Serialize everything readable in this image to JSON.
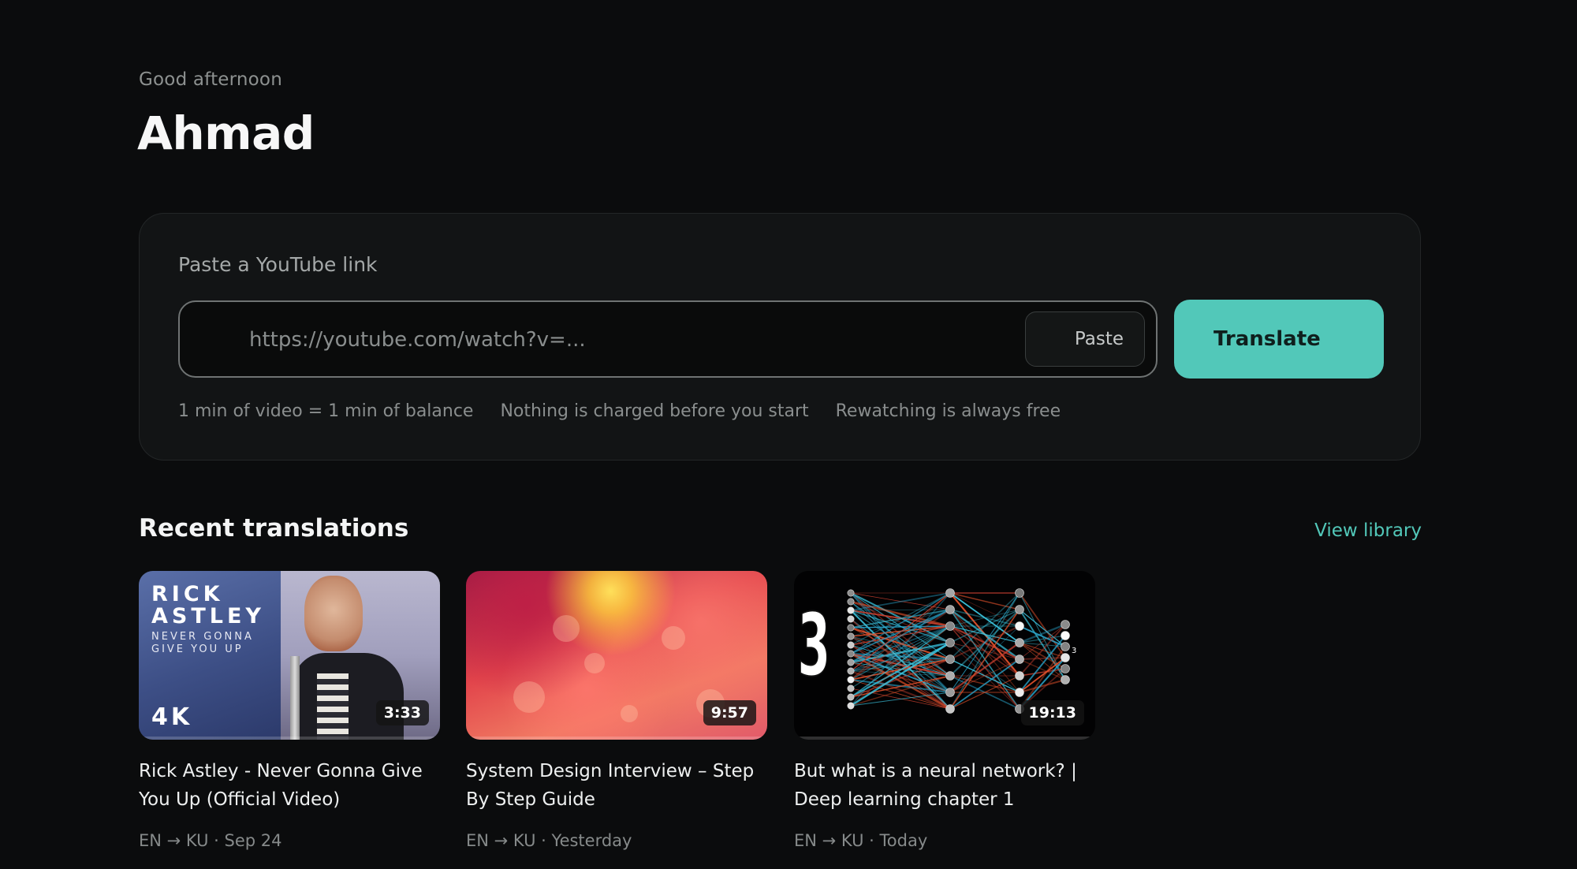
{
  "header": {
    "greeting": "Good afternoon",
    "username": "Ahmad"
  },
  "translate_card": {
    "label": "Paste a YouTube link",
    "url_placeholder": "https://youtube.com/watch?v=...",
    "url_value": "",
    "paste_label": "Paste",
    "translate_label": "Translate",
    "notes": [
      "1 min of video = 1 min of balance",
      "Nothing is charged before you start",
      "Rewatching is always free"
    ]
  },
  "recent": {
    "title": "Recent translations",
    "view_library_label": "View library",
    "items": [
      {
        "title": "Rick Astley - Never Gonna Give You Up (Official Video)",
        "duration": "3:33",
        "meta": "EN → KU · Sep 24",
        "thumb_text": {
          "name_line1": "RICK",
          "name_line2": "ASTLEY",
          "sub_line1": "NEVER GONNA",
          "sub_line2": "GIVE YOU UP",
          "badge": "4K"
        }
      },
      {
        "title": "System Design Interview – Step By Step Guide",
        "duration": "9:57",
        "meta": "EN → KU · Yesterday"
      },
      {
        "title": "But what is a neural network? | Deep learning chapter 1",
        "duration": "19:13",
        "meta": "EN → KU · Today",
        "thumb_text": {
          "digit": "3",
          "output_label": "3"
        }
      }
    ]
  },
  "colors": {
    "background": "#0b0c0d",
    "accent": "#52c8b9",
    "card": "#121415"
  }
}
